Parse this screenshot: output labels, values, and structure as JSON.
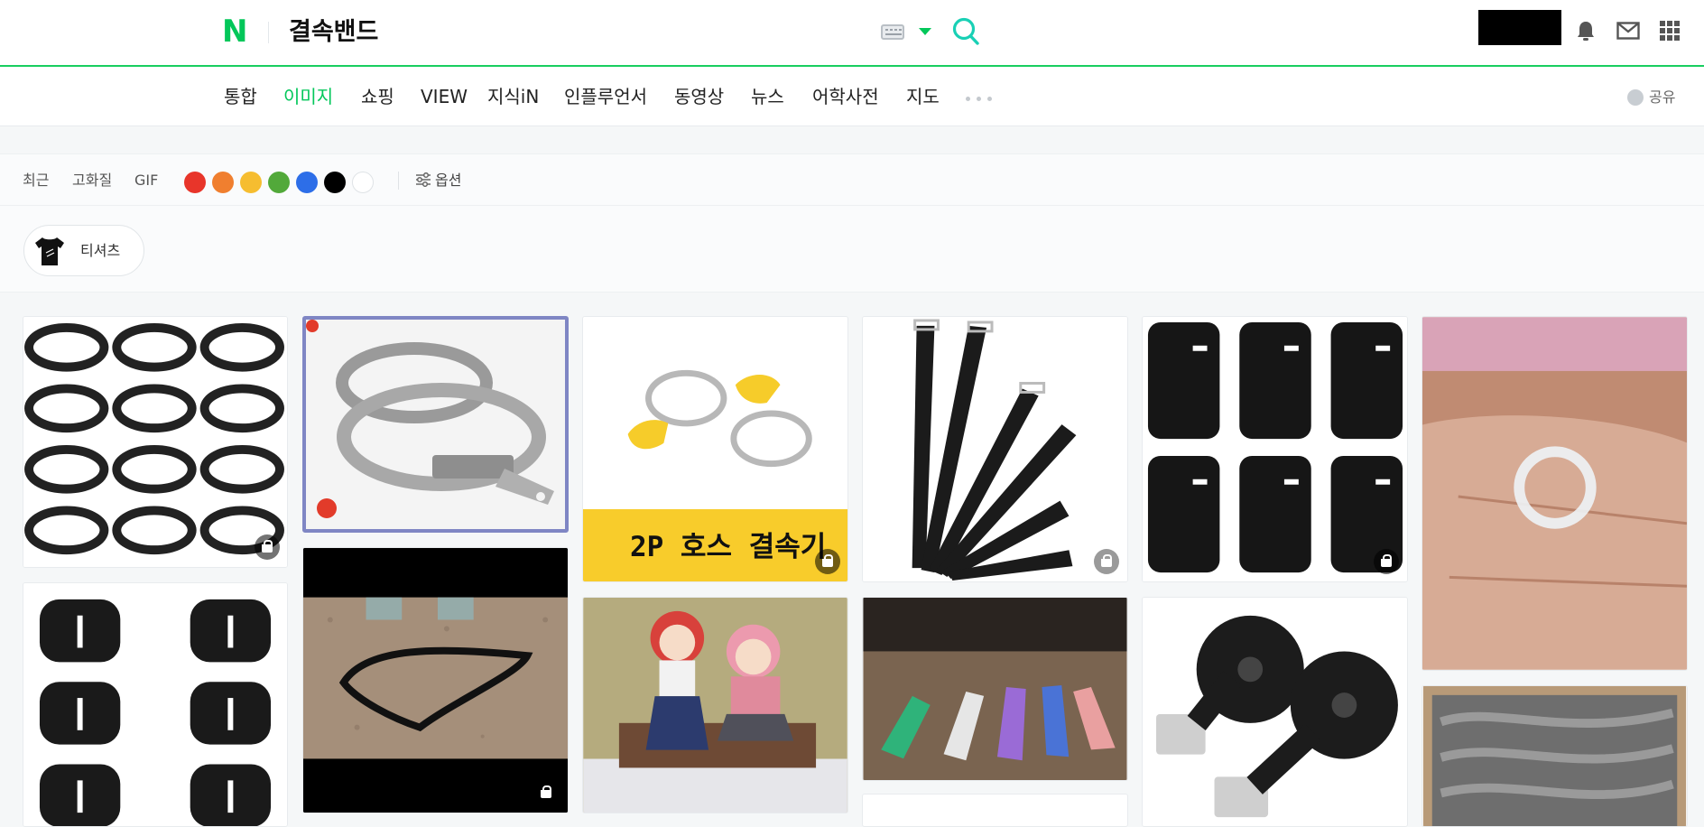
{
  "header": {
    "logo": "N",
    "query": "결속밴드"
  },
  "tabs": [
    {
      "label": "통합",
      "active": false
    },
    {
      "label": "이미지",
      "active": true
    },
    {
      "label": "쇼핑",
      "active": false
    },
    {
      "label": "VIEW",
      "active": false
    },
    {
      "label": "지식iN",
      "active": false
    },
    {
      "label": "인플루언서",
      "active": false
    },
    {
      "label": "동영상",
      "active": false
    },
    {
      "label": "뉴스",
      "active": false
    },
    {
      "label": "어학사전",
      "active": false
    },
    {
      "label": "지도",
      "active": false
    }
  ],
  "share_label": "공유",
  "filters": {
    "recent": "최근",
    "hd": "고화질",
    "gif": "GIF",
    "colors": [
      "#e8352a",
      "#f07f2f",
      "#f6bd30",
      "#52a93a",
      "#2d6ee8",
      "#000000",
      "#ffffff"
    ],
    "options_label": "옵션"
  },
  "chip": {
    "label": "티셔츠"
  },
  "results": {
    "hose_caption": "2P 호스 결속기"
  },
  "accent_color": "#03c75a"
}
